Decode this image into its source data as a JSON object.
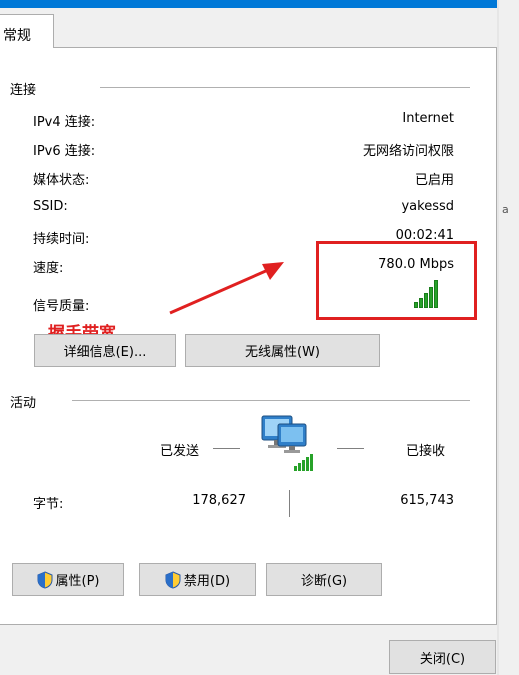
{
  "tab": {
    "label": "常规"
  },
  "right_fragment": "a",
  "connection": {
    "title": "连接",
    "rows": [
      {
        "label": "IPv4 连接:",
        "value": "Internet"
      },
      {
        "label": "IPv6 连接:",
        "value": "无网络访问权限"
      },
      {
        "label": "媒体状态:",
        "value": "已启用"
      },
      {
        "label": "SSID:",
        "value": "yakessd"
      },
      {
        "label": "持续时间:",
        "value": "00:02:41"
      },
      {
        "label": "速度:",
        "value": "780.0 Mbps"
      },
      {
        "label": "信号质量:",
        "value": ""
      }
    ],
    "signal_bars": 5
  },
  "annotation": {
    "text": "握手带宽",
    "color": "#e02020"
  },
  "buttons": {
    "details": "详细信息(E)...",
    "wireless": "无线属性(W)",
    "properties": "属性(P)",
    "disable": "禁用(D)",
    "diagnose": "诊断(G)",
    "close": "关闭(C)"
  },
  "activity": {
    "title": "活动",
    "sent_label": "已发送",
    "received_label": "已接收",
    "bytes_label": "字节:",
    "bytes_sent": "178,627",
    "bytes_received": "615,743"
  },
  "colors": {
    "accent": "#0078d7",
    "signal": "#27a229",
    "annotation": "#e02020"
  }
}
